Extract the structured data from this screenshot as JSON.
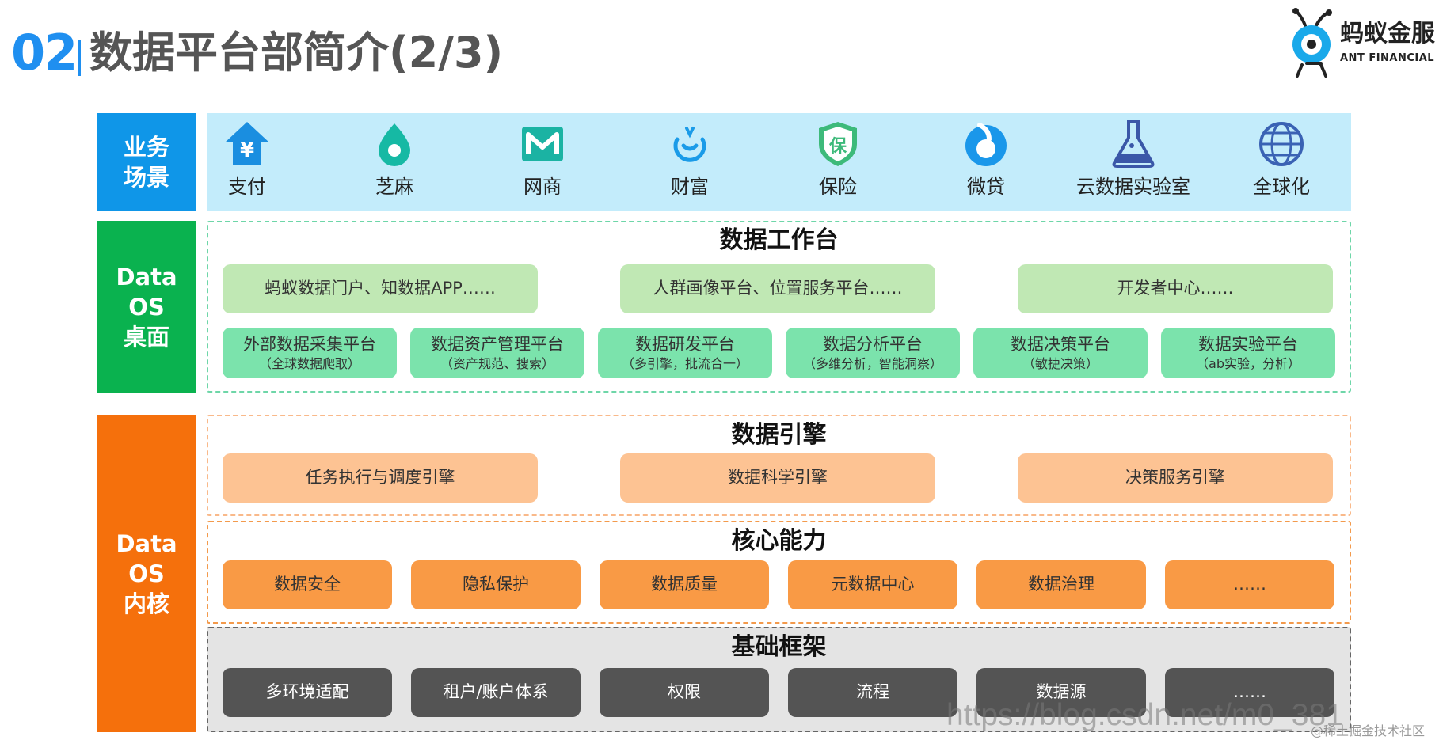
{
  "header": {
    "number": "02",
    "title": "数据平台部简介(2/3)"
  },
  "logo": {
    "name_cn": "蚂蚁金服",
    "name_en": "ANT FINANCIAL",
    "icon": "ant-icon"
  },
  "sides": {
    "business": "业务\n场景",
    "desktop": "Data\nOS\n桌面",
    "kernel": "Data\nOS\n内核"
  },
  "business_items": [
    {
      "label": "支付",
      "icon": "yuan-house-icon"
    },
    {
      "label": "芝麻",
      "icon": "sesame-icon"
    },
    {
      "label": "网商",
      "icon": "mybank-icon"
    },
    {
      "label": "财富",
      "icon": "wealth-icon"
    },
    {
      "label": "保险",
      "icon": "insurance-shield-icon"
    },
    {
      "label": "微贷",
      "icon": "microloan-icon"
    },
    {
      "label": "云数据实验室",
      "icon": "flask-icon"
    },
    {
      "label": "全球化",
      "icon": "globe-icon"
    }
  ],
  "workbench": {
    "title": "数据工作台",
    "top": [
      "蚂蚁数据门户、知数据APP……",
      "人群画像平台、位置服务平台……",
      "开发者中心……"
    ],
    "platforms": [
      {
        "name": "外部数据采集平台",
        "sub": "（全球数据爬取）"
      },
      {
        "name": "数据资产管理平台",
        "sub": "（资产规范、搜索）"
      },
      {
        "name": "数据研发平台",
        "sub": "（多引擎，批流合一）"
      },
      {
        "name": "数据分析平台",
        "sub": "（多维分析，智能洞察）"
      },
      {
        "name": "数据决策平台",
        "sub": "（敏捷决策）"
      },
      {
        "name": "数据实验平台",
        "sub": "（ab实验，分析）"
      }
    ]
  },
  "engine": {
    "title": "数据引擎",
    "items": [
      "任务执行与调度引擎",
      "数据科学引擎",
      "决策服务引擎"
    ]
  },
  "core": {
    "title": "核心能力",
    "items": [
      "数据安全",
      "隐私保护",
      "数据质量",
      "元数据中心",
      "数据治理",
      "……"
    ]
  },
  "base": {
    "title": "基础框架",
    "items": [
      "多环境适配",
      "租户/账户体系",
      "权限",
      "流程",
      "数据源",
      "……"
    ]
  },
  "watermark": {
    "url": "https://blog.csdn.net/m0_381",
    "credit": "@稀土掘金技术社区"
  },
  "colors": {
    "accent_blue": "#1f8ff0",
    "business": "#0f96e8",
    "desktop": "#0ab24f",
    "kernel": "#f5700c",
    "band": "#c3ecfb"
  }
}
